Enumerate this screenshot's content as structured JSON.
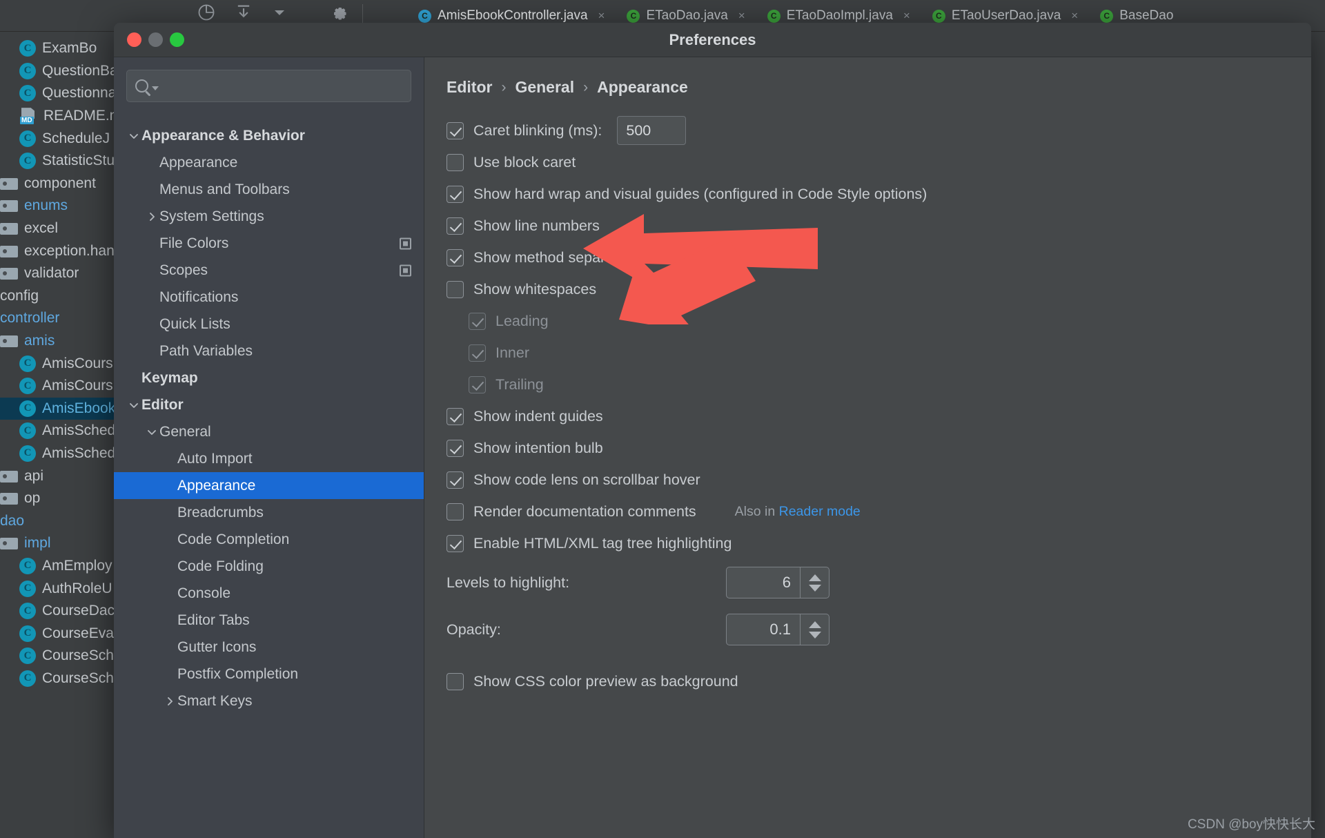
{
  "ide": {
    "tabs": [
      {
        "label": "AmisEbookController.java",
        "icon": "blue-dot-icon",
        "active": true
      },
      {
        "label": "ETaoDao.java",
        "icon": "green-dot-icon",
        "active": false
      },
      {
        "label": "ETaoDaoImpl.java",
        "icon": "green-dot-icon",
        "active": false
      },
      {
        "label": "ETaoUserDao.java",
        "icon": "green-dot-icon",
        "active": false
      },
      {
        "label": "BaseDao",
        "icon": "green-dot-icon",
        "active": false
      }
    ],
    "project_tree": [
      {
        "label": "ExamBo",
        "icon": "class-icon",
        "indent": 2,
        "color": "normal"
      },
      {
        "label": "QuestionBa",
        "icon": "class-icon",
        "indent": 2,
        "color": "normal"
      },
      {
        "label": "Questionna",
        "icon": "class-icon",
        "indent": 2,
        "color": "normal"
      },
      {
        "label": "README.m",
        "icon": "markdown-icon",
        "indent": 2,
        "color": "normal"
      },
      {
        "label": "ScheduleJ",
        "icon": "class-icon",
        "indent": 2,
        "color": "normal"
      },
      {
        "label": "StatisticStu",
        "icon": "class-icon",
        "indent": 2,
        "color": "normal"
      },
      {
        "label": "component",
        "icon": "folder-icon",
        "indent": 0,
        "color": "normal"
      },
      {
        "label": "enums",
        "icon": "folder-icon",
        "indent": 0,
        "color": "blue"
      },
      {
        "label": "excel",
        "icon": "folder-icon",
        "indent": 0,
        "color": "normal"
      },
      {
        "label": "exception.han",
        "icon": "folder-icon",
        "indent": 0,
        "color": "normal"
      },
      {
        "label": "validator",
        "icon": "folder-icon",
        "indent": 0,
        "color": "normal"
      },
      {
        "label": "config",
        "icon": "none",
        "indent": 0,
        "color": "normal"
      },
      {
        "label": "controller",
        "icon": "none",
        "indent": 0,
        "color": "blue"
      },
      {
        "label": "amis",
        "icon": "folder-icon",
        "indent": 0,
        "color": "blue"
      },
      {
        "label": "AmisCours",
        "icon": "class-icon",
        "indent": 2,
        "color": "normal"
      },
      {
        "label": "AmisCours",
        "icon": "class-icon",
        "indent": 2,
        "color": "normal"
      },
      {
        "label": "AmisEbook",
        "icon": "class-icon",
        "indent": 2,
        "color": "blue",
        "selected": true
      },
      {
        "label": "AmisSched",
        "icon": "class-icon",
        "indent": 2,
        "color": "normal"
      },
      {
        "label": "AmisSched",
        "icon": "class-icon",
        "indent": 2,
        "color": "normal"
      },
      {
        "label": "api",
        "icon": "folder-icon",
        "indent": 0,
        "color": "normal"
      },
      {
        "label": "op",
        "icon": "folder-icon",
        "indent": 0,
        "color": "normal"
      },
      {
        "label": "dao",
        "icon": "none",
        "indent": 0,
        "color": "blue"
      },
      {
        "label": "impl",
        "icon": "folder-icon",
        "indent": 0,
        "color": "blue"
      },
      {
        "label": "AmEmploy",
        "icon": "class-icon",
        "indent": 2,
        "color": "normal"
      },
      {
        "label": "AuthRoleU",
        "icon": "class-icon",
        "indent": 2,
        "color": "normal"
      },
      {
        "label": "CourseDac",
        "icon": "class-icon",
        "indent": 2,
        "color": "normal"
      },
      {
        "label": "CourseEva",
        "icon": "class-icon",
        "indent": 2,
        "color": "normal"
      },
      {
        "label": "CourseSch",
        "icon": "class-icon",
        "indent": 2,
        "color": "normal"
      },
      {
        "label": "CourseSch",
        "icon": "class-icon",
        "indent": 2,
        "color": "normal"
      }
    ]
  },
  "dialog": {
    "title": "Preferences",
    "window_controls": {
      "close": "close-button",
      "minimize": "minimize-button",
      "zoom": "zoom-button"
    },
    "search": {
      "value": "",
      "placeholder": ""
    },
    "tree": [
      {
        "label": "Appearance & Behavior",
        "indent": 0,
        "chevron": "down",
        "bold": true
      },
      {
        "label": "Appearance",
        "indent": 1,
        "chevron": "none",
        "bold": false
      },
      {
        "label": "Menus and Toolbars",
        "indent": 1,
        "chevron": "none",
        "bold": false
      },
      {
        "label": "System Settings",
        "indent": 1,
        "chevron": "right",
        "bold": false
      },
      {
        "label": "File Colors",
        "indent": 1,
        "chevron": "none",
        "bold": false,
        "gear": true
      },
      {
        "label": "Scopes",
        "indent": 1,
        "chevron": "none",
        "bold": false,
        "gear": true
      },
      {
        "label": "Notifications",
        "indent": 1,
        "chevron": "none",
        "bold": false
      },
      {
        "label": "Quick Lists",
        "indent": 1,
        "chevron": "none",
        "bold": false
      },
      {
        "label": "Path Variables",
        "indent": 1,
        "chevron": "none",
        "bold": false
      },
      {
        "label": "Keymap",
        "indent": 0,
        "chevron": "none",
        "bold": true
      },
      {
        "label": "Editor",
        "indent": 0,
        "chevron": "down",
        "bold": true
      },
      {
        "label": "General",
        "indent": 1,
        "chevron": "down",
        "bold": false
      },
      {
        "label": "Auto Import",
        "indent": 2,
        "chevron": "none",
        "bold": false
      },
      {
        "label": "Appearance",
        "indent": 2,
        "chevron": "none",
        "bold": false,
        "selected": true
      },
      {
        "label": "Breadcrumbs",
        "indent": 2,
        "chevron": "none",
        "bold": false
      },
      {
        "label": "Code Completion",
        "indent": 2,
        "chevron": "none",
        "bold": false
      },
      {
        "label": "Code Folding",
        "indent": 2,
        "chevron": "none",
        "bold": false
      },
      {
        "label": "Console",
        "indent": 2,
        "chevron": "none",
        "bold": false
      },
      {
        "label": "Editor Tabs",
        "indent": 2,
        "chevron": "none",
        "bold": false
      },
      {
        "label": "Gutter Icons",
        "indent": 2,
        "chevron": "none",
        "bold": false
      },
      {
        "label": "Postfix Completion",
        "indent": 2,
        "chevron": "none",
        "bold": false
      },
      {
        "label": "Smart Keys",
        "indent": 2,
        "chevron": "right",
        "bold": false
      }
    ],
    "breadcrumb": {
      "root": "Editor",
      "mid": "General",
      "leaf": "Appearance",
      "separator": "›"
    },
    "options": [
      {
        "label": "Caret blinking (ms):",
        "checked": true,
        "dim": false,
        "sub": false,
        "field": "500"
      },
      {
        "label": "Use block caret",
        "checked": false,
        "dim": false,
        "sub": false
      },
      {
        "label": "Show hard wrap and visual guides (configured in Code Style options)",
        "checked": true,
        "dim": false,
        "sub": false
      },
      {
        "label": "Show line numbers",
        "checked": true,
        "dim": false,
        "sub": false
      },
      {
        "label": "Show method separators",
        "checked": true,
        "dim": false,
        "sub": false
      },
      {
        "label": "Show whitespaces",
        "checked": false,
        "dim": false,
        "sub": false
      },
      {
        "label": "Leading",
        "checked": true,
        "dim": true,
        "sub": true
      },
      {
        "label": "Inner",
        "checked": true,
        "dim": true,
        "sub": true
      },
      {
        "label": "Trailing",
        "checked": true,
        "dim": true,
        "sub": true
      },
      {
        "label": "Show indent guides",
        "checked": true,
        "dim": false,
        "sub": false
      },
      {
        "label": "Show intention bulb",
        "checked": true,
        "dim": false,
        "sub": false
      },
      {
        "label": "Show code lens on scrollbar hover",
        "checked": true,
        "dim": false,
        "sub": false
      },
      {
        "label": "Render documentation comments",
        "checked": false,
        "dim": false,
        "sub": false,
        "also_prefix": "Also in ",
        "also_link": "Reader mode"
      },
      {
        "label": "Enable HTML/XML tag tree highlighting",
        "checked": true,
        "dim": false,
        "sub": false
      }
    ],
    "spinners": [
      {
        "label": "Levels to highlight:",
        "value": "6"
      },
      {
        "label": "Opacity:",
        "value": "0.1"
      }
    ],
    "trailing_option": {
      "label": "Show CSS color preview as background",
      "checked": false
    }
  },
  "annotations": {
    "arrow_color": "#f4584f",
    "arrows": [
      {
        "name": "arrow-to-show-line-numbers"
      },
      {
        "name": "arrow-to-show-method-separators"
      }
    ]
  },
  "watermark": "CSDN @boy快快长大"
}
